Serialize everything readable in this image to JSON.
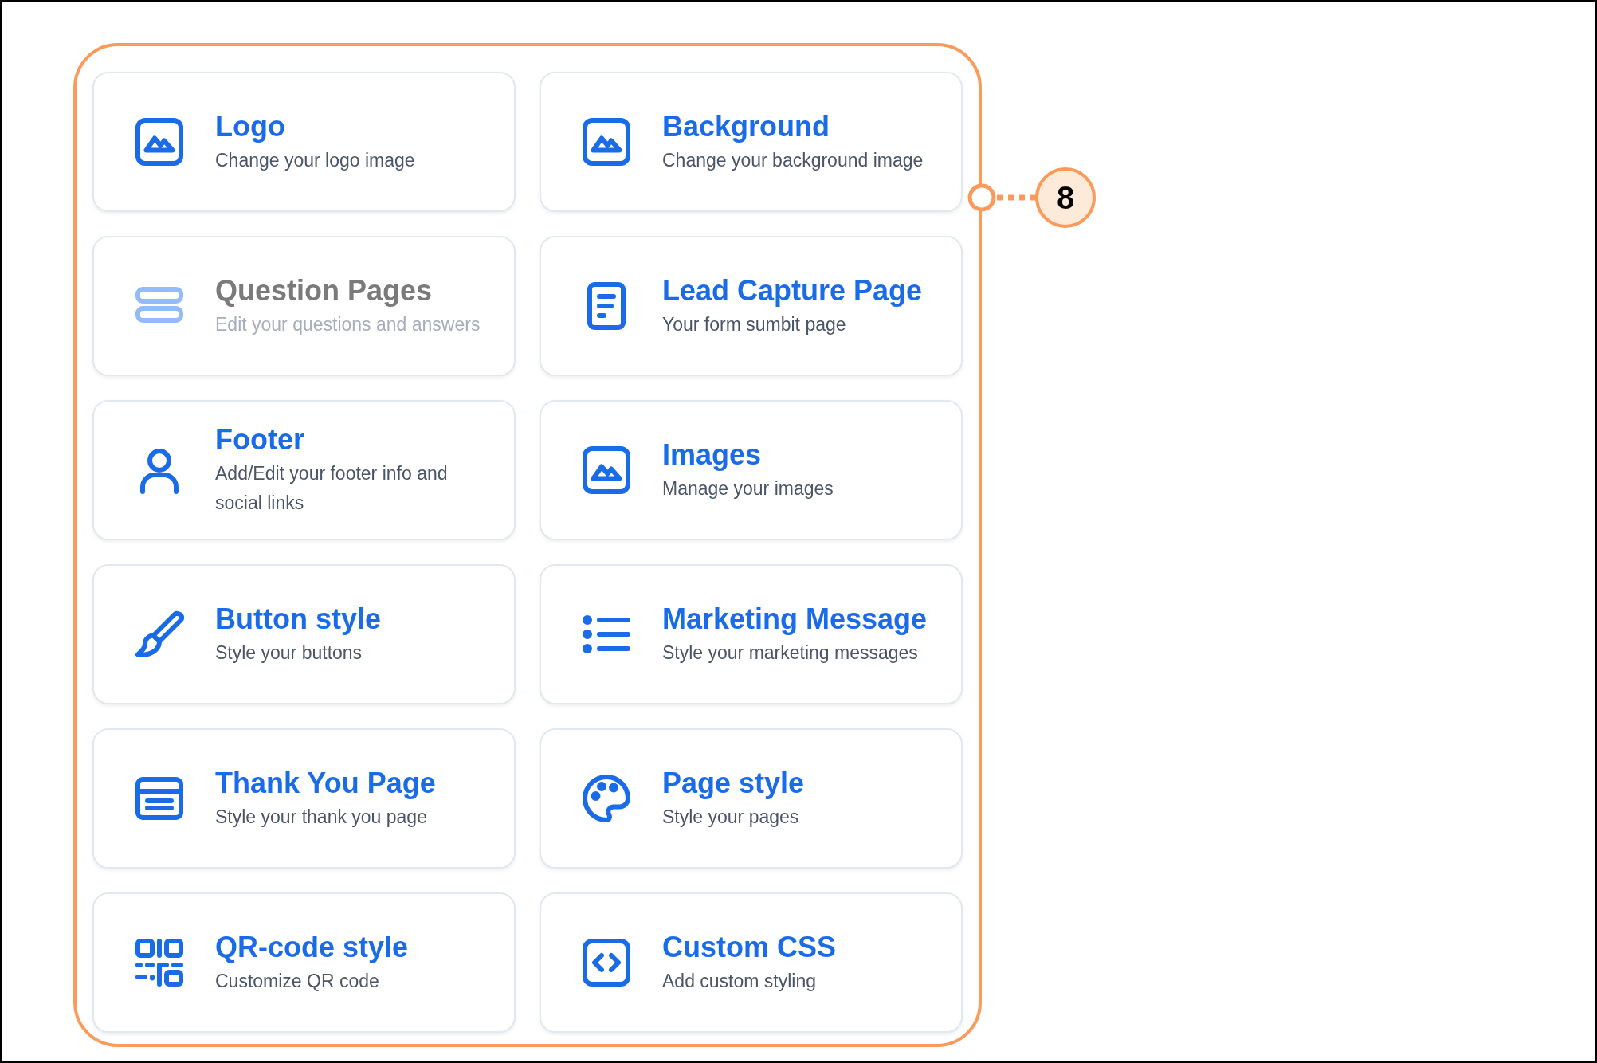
{
  "cards": [
    {
      "title": "Logo",
      "description": "Change your logo image",
      "disabled": false
    },
    {
      "title": "Background",
      "description": "Change your background image",
      "disabled": false
    },
    {
      "title": "Question Pages",
      "description": "Edit your questions and answers",
      "disabled": true
    },
    {
      "title": "Lead Capture Page",
      "description": "Your form sumbit page",
      "disabled": false
    },
    {
      "title": "Footer",
      "description": "Add/Edit your footer info and social links",
      "disabled": false
    },
    {
      "title": "Images",
      "description": "Manage your images",
      "disabled": false
    },
    {
      "title": "Button style",
      "description": "Style your buttons",
      "disabled": false
    },
    {
      "title": "Marketing Message",
      "description": "Style your marketing messages",
      "disabled": false
    },
    {
      "title": "Thank You Page",
      "description": "Style your thank you page",
      "disabled": false
    },
    {
      "title": "Page style",
      "description": "Style your pages",
      "disabled": false
    },
    {
      "title": "QR-code style",
      "description": "Customize QR code",
      "disabled": false
    },
    {
      "title": "Custom CSS",
      "description": "Add custom styling",
      "disabled": false
    }
  ],
  "callout": {
    "number": "8"
  }
}
